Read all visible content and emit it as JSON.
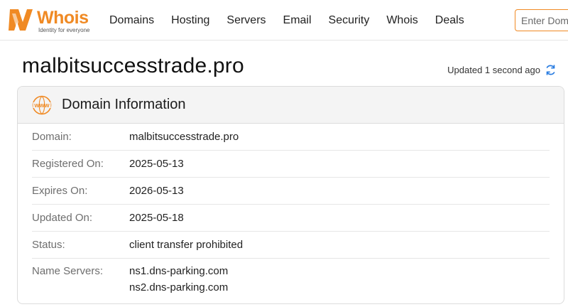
{
  "header": {
    "logo_text": "Whois",
    "logo_tagline": "Identity for everyone",
    "nav": [
      "Domains",
      "Hosting",
      "Servers",
      "Email",
      "Security",
      "Whois",
      "Deals"
    ],
    "search_placeholder": "Enter Domain",
    "accent_color": "#f08a24"
  },
  "page": {
    "title": "malbitsuccesstrade.pro",
    "updated_text": "Updated 1 second ago"
  },
  "card": {
    "title": "Domain Information",
    "rows": [
      {
        "label": "Domain:",
        "value": "malbitsuccesstrade.pro"
      },
      {
        "label": "Registered On:",
        "value": "2025-05-13"
      },
      {
        "label": "Expires On:",
        "value": "2026-05-13"
      },
      {
        "label": "Updated On:",
        "value": "2025-05-18"
      },
      {
        "label": "Status:",
        "value": "client transfer prohibited"
      }
    ],
    "name_servers_label": "Name Servers:",
    "name_servers": [
      "ns1.dns-parking.com",
      "ns2.dns-parking.com"
    ]
  },
  "icons": {
    "logo": "whois-logo-icon",
    "refresh": "refresh-icon",
    "www": "www-globe-icon"
  }
}
